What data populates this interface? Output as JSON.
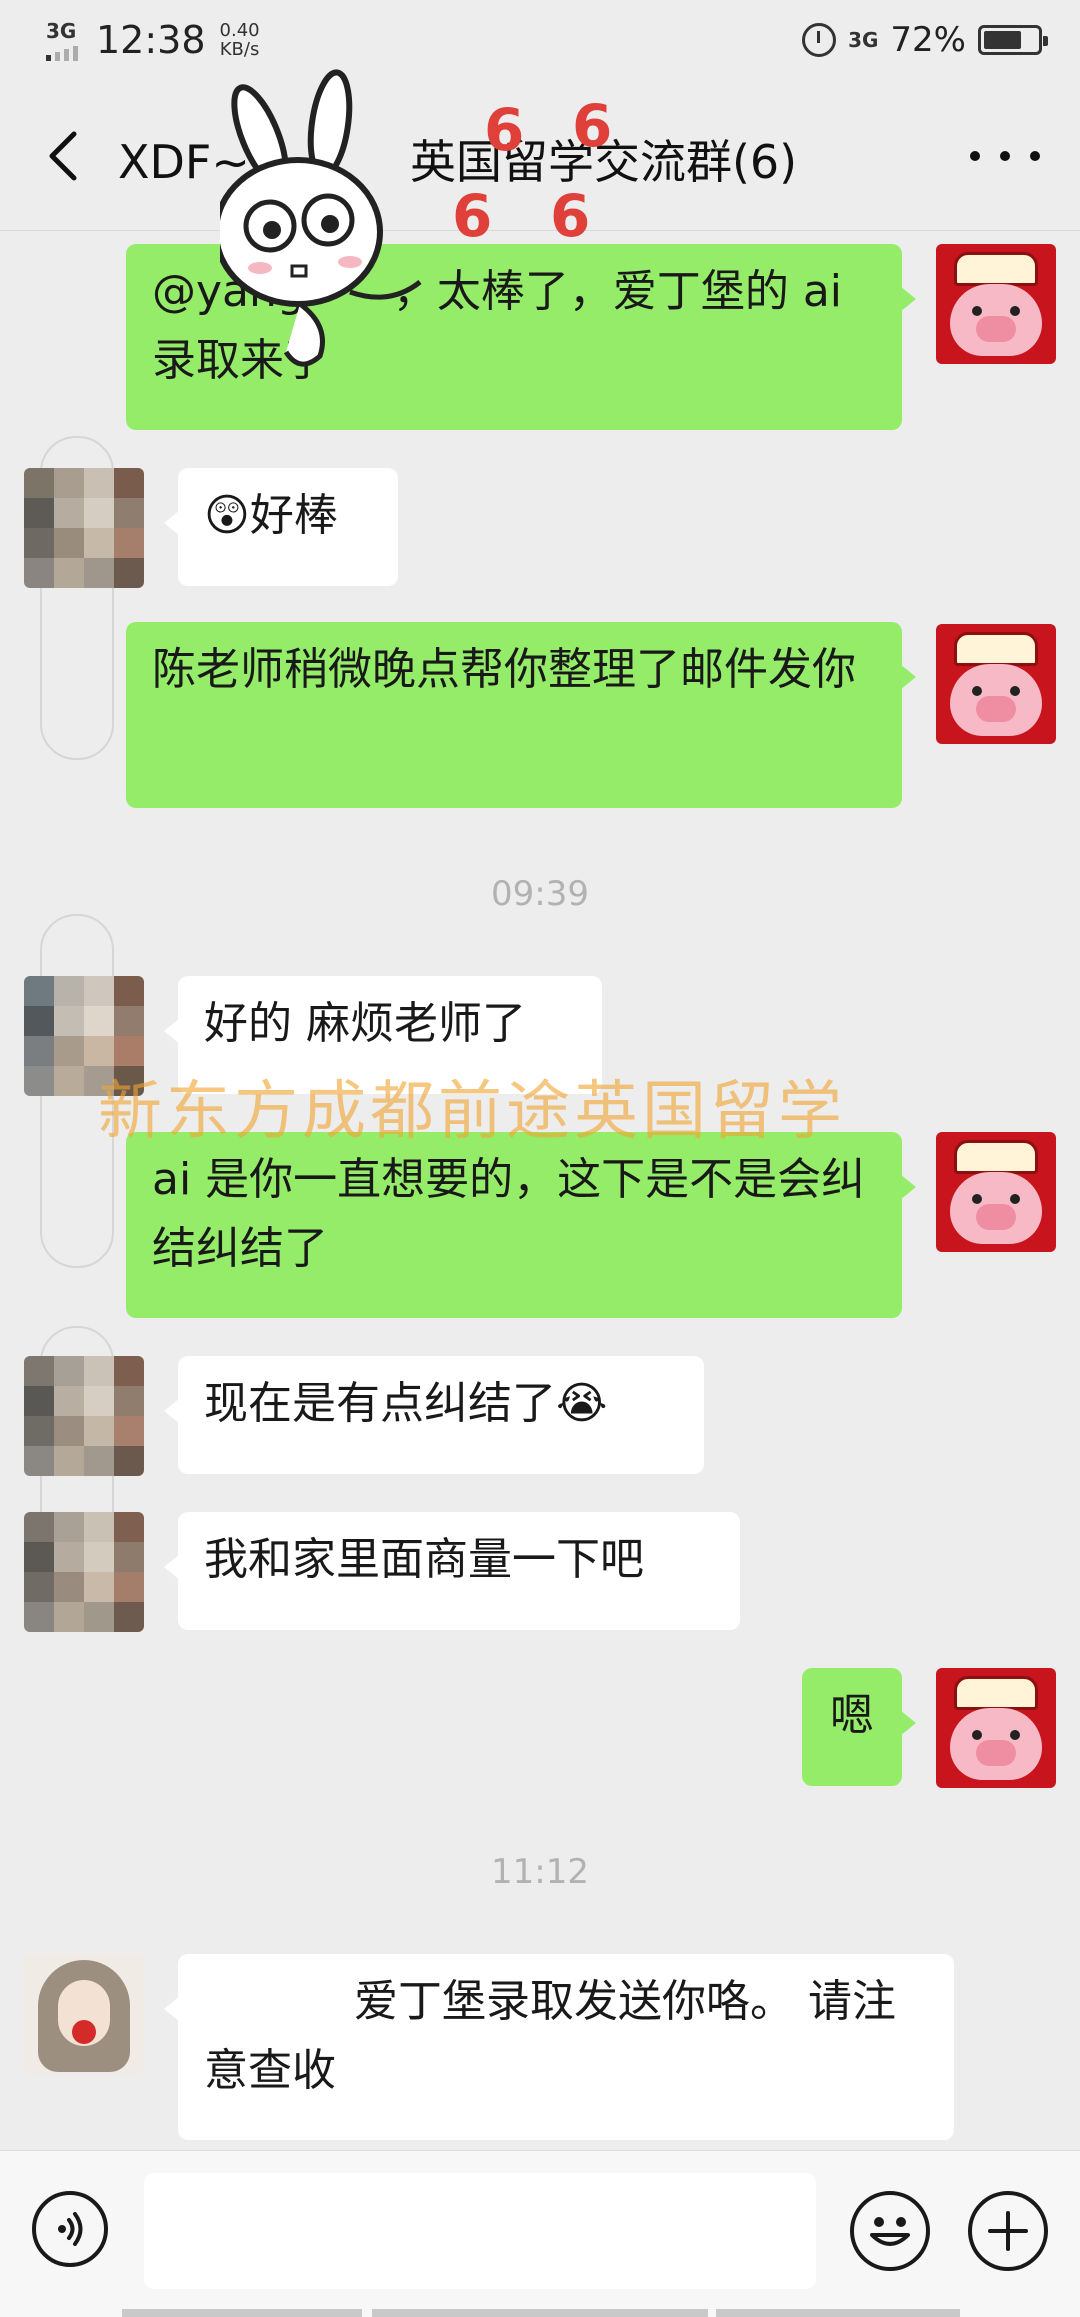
{
  "status_bar": {
    "network_left": "3G",
    "time": "12:38",
    "speed_value": "0.40",
    "speed_unit": "KB/s",
    "network_right": "3G",
    "battery_percent": "72%",
    "battery_level": 0.72
  },
  "header": {
    "title_visible": "XDF~",
    "title_visible_rest": "英国留学交流群(6)"
  },
  "sticker": {
    "caption": "6  6  6  6"
  },
  "messages": [
    {
      "side": "me",
      "text": "@yang",
      "text_rest": "，太棒了，爱丁堡的 ai 录取来了"
    },
    {
      "side": "other",
      "emoji": "😲",
      "text": "好棒"
    },
    {
      "side": "me",
      "text": "陈老师稍微晚点帮你整理了邮件发你"
    },
    {
      "type": "time",
      "text": "09:39"
    },
    {
      "side": "other",
      "text": "好的 麻烦老师了"
    },
    {
      "side": "me",
      "text": "ai 是你一直想要的，这下是不是会纠结纠结了"
    },
    {
      "side": "other",
      "text": "现在是有点纠结了",
      "emoji": "😭"
    },
    {
      "side": "other",
      "text": "我和家里面商量一下吧"
    },
    {
      "side": "me",
      "text": "嗯"
    },
    {
      "type": "time",
      "text": "11:12"
    },
    {
      "side": "other",
      "text": "爱丁堡录取发送你咯。 请注意查收"
    }
  ],
  "watermark": "新东方成都前途英国留学",
  "input_bar": {
    "voice_icon": "voice-icon",
    "emoji_icon": "emoji-icon",
    "plus_icon": "plus-icon"
  },
  "colors": {
    "my_bubble": "#95ec69",
    "other_bubble": "#ffffff",
    "background": "#ededed"
  }
}
